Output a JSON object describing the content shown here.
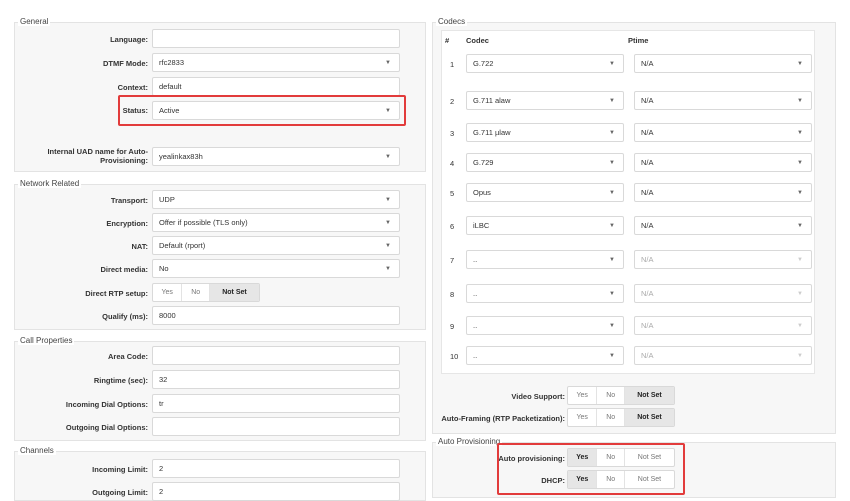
{
  "general": {
    "legend": "General",
    "language_label": "Language:",
    "language_value": "",
    "dtmf_label": "DTMF Mode:",
    "dtmf_value": "rfc2833",
    "context_label": "Context:",
    "context_value": "default",
    "status_label": "Status:",
    "status_value": "Active",
    "uad_label": "Internal UAD name for Auto-Provisioning:",
    "uad_value": "yealinkax83h"
  },
  "network": {
    "legend": "Network Related",
    "transport_label": "Transport:",
    "transport_value": "UDP",
    "encryption_label": "Encryption:",
    "encryption_value": "Offer if possible (TLS only)",
    "nat_label": "NAT:",
    "nat_value": "Default (rport)",
    "direct_media_label": "Direct media:",
    "direct_media_value": "No",
    "direct_rtp_label": "Direct RTP setup:",
    "direct_rtp_options": [
      "Yes",
      "No",
      "Not Set"
    ],
    "qualify_label": "Qualify (ms):",
    "qualify_value": "8000"
  },
  "call": {
    "legend": "Call Properties",
    "area_code_label": "Area Code:",
    "area_code_value": "",
    "ringtime_label": "Ringtime (sec):",
    "ringtime_value": "32",
    "incoming_dial_label": "Incoming Dial Options:",
    "incoming_dial_value": "tr",
    "outgoing_dial_label": "Outgoing Dial Options:",
    "outgoing_dial_value": ""
  },
  "channels": {
    "legend": "Channels",
    "incoming_label": "Incoming Limit:",
    "incoming_value": "2",
    "outgoing_label": "Outgoing Limit:",
    "outgoing_value": "2"
  },
  "codecs": {
    "legend": "Codecs",
    "col_num": "#",
    "col_codec": "Codec",
    "col_ptime": "Ptime",
    "rows": [
      {
        "num": "1",
        "codec": "G.722",
        "ptime": "N/A",
        "enabled": true
      },
      {
        "num": "2",
        "codec": "G.711 alaw",
        "ptime": "N/A",
        "enabled": true
      },
      {
        "num": "3",
        "codec": "G.711 µlaw",
        "ptime": "N/A",
        "enabled": true
      },
      {
        "num": "4",
        "codec": "G.729",
        "ptime": "N/A",
        "enabled": true
      },
      {
        "num": "5",
        "codec": "Opus",
        "ptime": "N/A",
        "enabled": true
      },
      {
        "num": "6",
        "codec": "iLBC",
        "ptime": "N/A",
        "enabled": true
      },
      {
        "num": "7",
        "codec": "..",
        "ptime": "N/A",
        "enabled": false
      },
      {
        "num": "8",
        "codec": "..",
        "ptime": "N/A",
        "enabled": false
      },
      {
        "num": "9",
        "codec": "..",
        "ptime": "N/A",
        "enabled": false
      },
      {
        "num": "10",
        "codec": "..",
        "ptime": "N/A",
        "enabled": false
      }
    ],
    "video_label": "Video Support:",
    "video_options": [
      "Yes",
      "No",
      "Not Set"
    ],
    "autoframe_label": "Auto-Framing (RTP Packetization):",
    "autoframe_options": [
      "Yes",
      "No",
      "Not Set"
    ]
  },
  "autoprov": {
    "legend": "Auto Provisioning",
    "auto_label": "Auto provisioning:",
    "auto_options": [
      "Yes",
      "No",
      "Not Set"
    ],
    "dhcp_label": "DHCP:",
    "dhcp_options": [
      "Yes",
      "No",
      "Not Set"
    ]
  },
  "colors": {
    "highlight": "#e23b3b",
    "selected_segment": "#e6e6e6"
  }
}
